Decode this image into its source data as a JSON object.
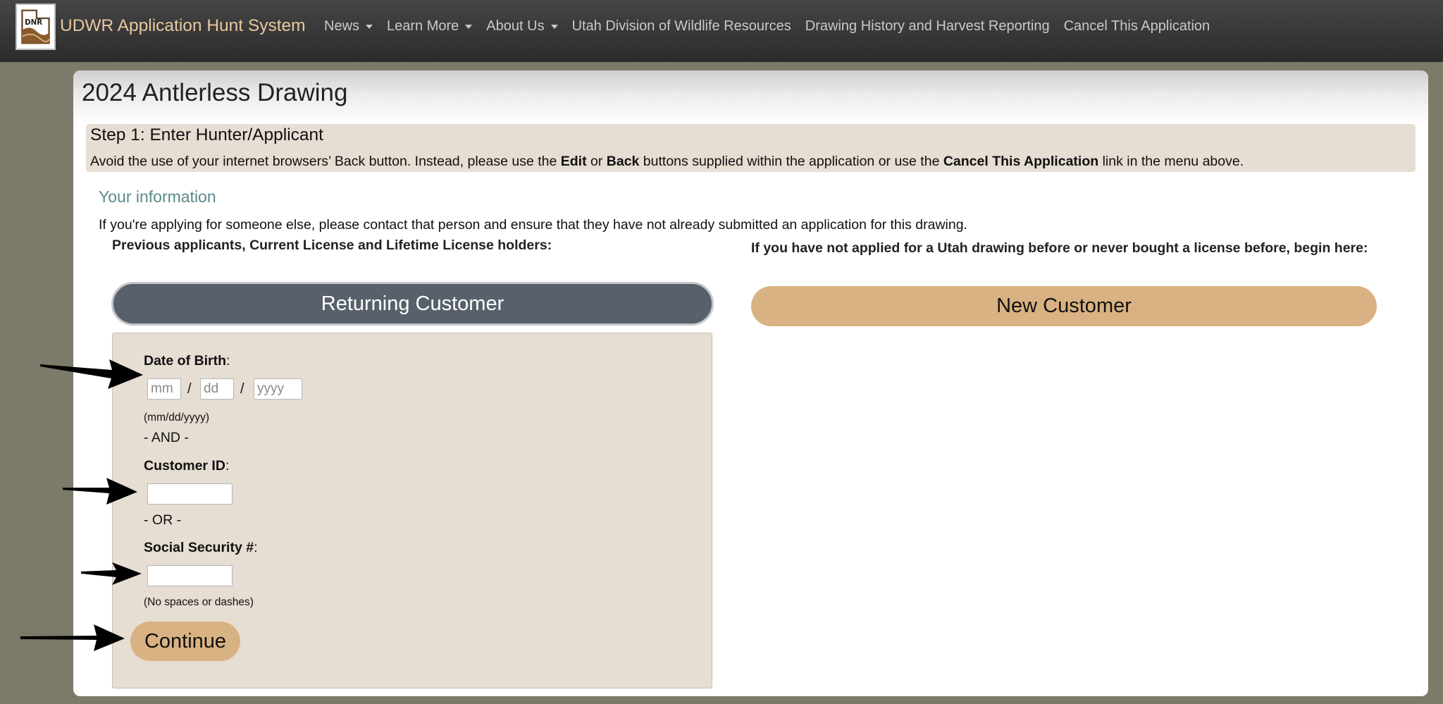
{
  "navbar": {
    "logo_text": "DNR",
    "brand": "UDWR Application Hunt System",
    "items": [
      {
        "label": "News",
        "dropdown": true
      },
      {
        "label": "Learn More",
        "dropdown": true
      },
      {
        "label": "About Us",
        "dropdown": true
      },
      {
        "label": "Utah Division of Wildlife Resources",
        "dropdown": false
      },
      {
        "label": "Drawing History and Harvest Reporting",
        "dropdown": false
      },
      {
        "label": "Cancel This Application",
        "dropdown": false
      }
    ]
  },
  "page": {
    "title": "2024 Antlerless Drawing",
    "step_title": "Step 1: Enter Hunter/Applicant",
    "step_note": {
      "part1": "Avoid the use of your internet browsers’ Back button. Instead, please use the ",
      "edit": "Edit",
      "part2": " or ",
      "back": "Back",
      "part3": " buttons supplied within the application or use the ",
      "cancel": "Cancel This Application",
      "part4": " link in the menu above."
    },
    "section_heading": "Your information",
    "intro": "If you're applying for someone else, please contact that person and ensure that they have not already submitted an application for this drawing.",
    "left_heading": "Previous applicants, Current License and Lifetime License holders:",
    "right_heading": "If you have not applied for a Utah drawing before or never bought a license before, begin here:",
    "returning_button": "Returning Customer",
    "new_button": "New Customer"
  },
  "form": {
    "dob_label": "Date of Birth",
    "colon": ":",
    "dob_mm_placeholder": "mm",
    "dob_dd_placeholder": "dd",
    "dob_yyyy_placeholder": "yyyy",
    "slash": "/",
    "dob_hint": "(mm/dd/yyyy)",
    "and_sep": "- AND -",
    "customer_id_label": "Customer ID",
    "customer_id_value": "",
    "or_sep": "- OR -",
    "ssn_label": "Social Security #",
    "ssn_value": "",
    "ssn_hint": "(No spaces or dashes)",
    "continue_button": "Continue"
  },
  "colors": {
    "navbar": "#2c2c2c",
    "brand": "#e8c7a0",
    "accent_tan": "#d9b283",
    "panel": "#e6ddd3",
    "returning": "#58616b",
    "section_heading": "#5b8a8a"
  }
}
